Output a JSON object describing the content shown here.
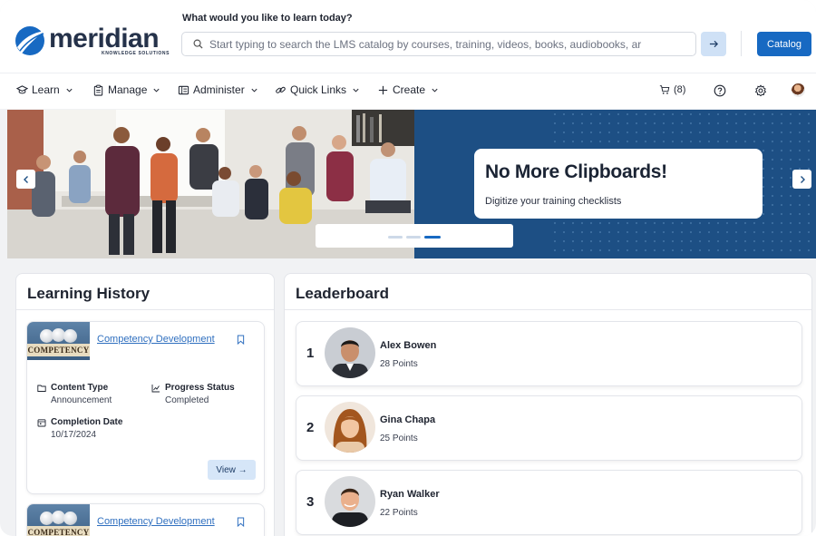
{
  "brand": {
    "name": "meridian",
    "tagline": "KNOWLEDGE SOLUTIONS",
    "mark_color": "#1769c2"
  },
  "search": {
    "prompt": "What would you like to learn today?",
    "placeholder": "Start typing to search the LMS catalog by courses, training, videos, books, audiobooks, ar",
    "catalog_label": "Catalog"
  },
  "nav": {
    "items": [
      {
        "label": "Learn",
        "icon": "graduation-cap-icon"
      },
      {
        "label": "Manage",
        "icon": "clipboard-icon"
      },
      {
        "label": "Administer",
        "icon": "admin-panel-icon"
      },
      {
        "label": "Quick Links",
        "icon": "link-icon"
      },
      {
        "label": "Create",
        "icon": "plus-icon"
      }
    ],
    "cart_label": "(8)"
  },
  "banner": {
    "title": "No More Clipboards!",
    "subtitle": "Digitize your training checklists",
    "background_color": "#1d4f84",
    "slide_count": 3,
    "active_slide": 3
  },
  "learning_history": {
    "title": "Learning History",
    "items": [
      {
        "thumb_text": "COMPETENCY",
        "title": "Competency Development",
        "content_type_label": "Content Type",
        "content_type": "Announcement",
        "progress_label": "Progress Status",
        "progress": "Completed",
        "completion_label": "Completion Date",
        "completion_date": "10/17/2024",
        "view_label": "View →"
      },
      {
        "thumb_text": "COMPETENCY",
        "title": "Competency Development"
      }
    ]
  },
  "leaderboard": {
    "title": "Leaderboard",
    "entries": [
      {
        "rank": "1",
        "name": "Alex Bowen",
        "points": "28 Points"
      },
      {
        "rank": "2",
        "name": "Gina Chapa",
        "points": "25 Points"
      },
      {
        "rank": "3",
        "name": "Ryan Walker",
        "points": "22 Points"
      }
    ]
  },
  "colors": {
    "primary": "#1769c2",
    "link": "#2f6fbf",
    "light_button": "#d6e6f8"
  }
}
